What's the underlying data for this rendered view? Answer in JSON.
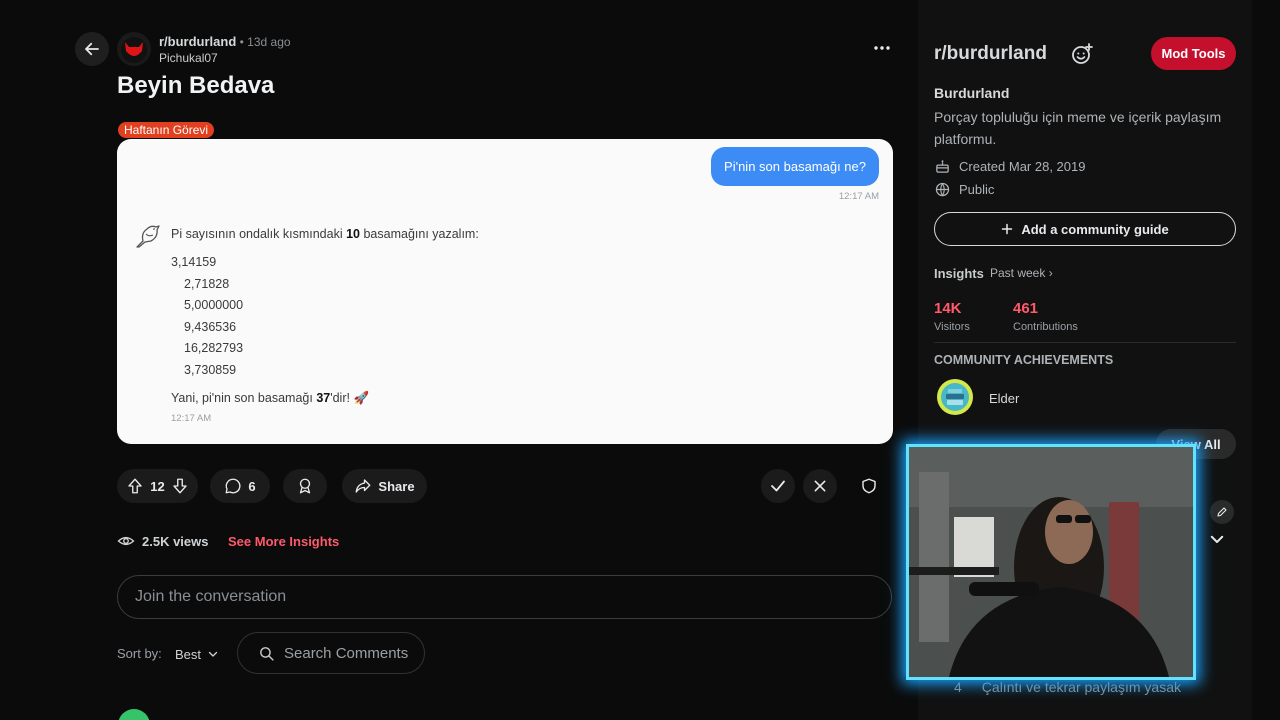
{
  "post": {
    "subreddit": "r/burdurland",
    "age": "13d ago",
    "separator": "•",
    "author": "Pichukal07",
    "title": "Beyin Bedava",
    "flair": "Haftanın Görevi"
  },
  "media": {
    "question": "Pi'nin son basamağı ne?",
    "question_time": "12:17 AM",
    "answer_intro_pre": "Pi sayısının ondalık kısmındaki ",
    "answer_intro_bold": "10",
    "answer_intro_post": " basamağını yazalım:",
    "numbers": [
      "3,14159",
      "2,71828",
      "5,0000000",
      "9,436536",
      "16,282793",
      "3,730859"
    ],
    "answer_end_pre": "Yani, pi'nin son basamağı ",
    "answer_end_bold": "37",
    "answer_end_post": "'dir! 🚀",
    "answer_time": "12:17 AM"
  },
  "actions": {
    "upvotes": "12",
    "comments": "6",
    "share_label": "Share"
  },
  "insights": {
    "views": "2.5K views",
    "see_more": "See More Insights"
  },
  "comment_box": {
    "placeholder": "Join the conversation",
    "sort_label": "Sort by:",
    "sort_value": "Best",
    "search_placeholder": "Search Comments"
  },
  "sidebar": {
    "title": "r/burdurland",
    "mod_tools": "Mod Tools",
    "name": "Burdurland",
    "description": "Porçay topluluğu için meme ve içerik paylaşım platformu.",
    "created": "Created Mar 28, 2019",
    "visibility": "Public",
    "guide_button": "Add a community guide",
    "insights_label": "Insights",
    "insights_range": "Past week",
    "visitors_value": "14K",
    "visitors_label": "Visitors",
    "contributions_value": "461",
    "contributions_label": "Contributions",
    "achievements_title": "COMMUNITY ACHIEVEMENTS",
    "achievement_name": "Elder",
    "view_all": "View All",
    "rule_number": "4",
    "rule_text": "Çalıntı ve tekrar paylaşım yasak"
  },
  "colors": {
    "accent_red": "#c4102d",
    "insight_pink": "#ff5a6b",
    "flair_orange": "#e0401f",
    "bubble_blue": "#3d8bf5",
    "cam_glow": "#5fe3ff"
  }
}
